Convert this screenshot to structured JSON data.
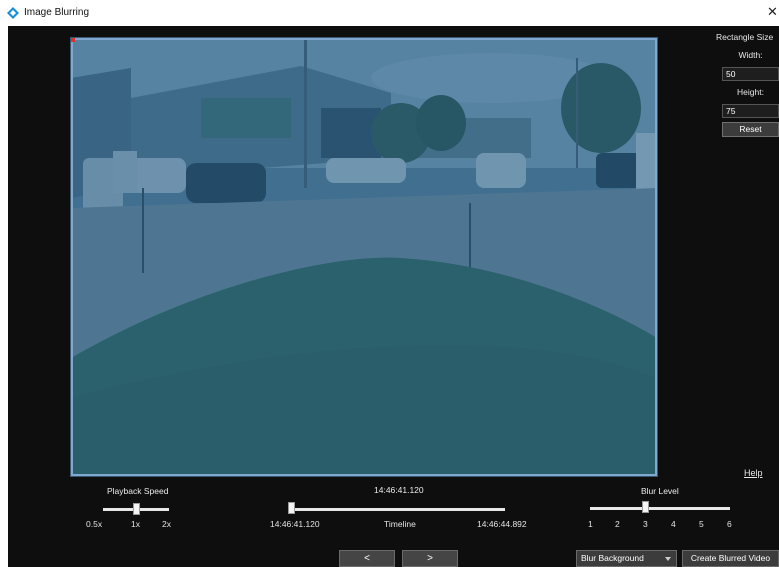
{
  "window": {
    "title": "Image Blurring",
    "close_glyph": "✕",
    "icon": "app-diamond-icon"
  },
  "colors": {
    "background": "#0e0e0e",
    "blur_overlay": "#1c5a87",
    "blur_border": "#7fa8d0",
    "accent_icon": "#1a8fd6"
  },
  "rectangle_size": {
    "title": "Rectangle Size",
    "width_label": "Width:",
    "width_value": "50",
    "height_label": "Height:",
    "height_value": "75",
    "reset_label": "Reset"
  },
  "help": {
    "label": "Help"
  },
  "playback_speed": {
    "label": "Playback Speed",
    "ticks": [
      "0.5x",
      "1x",
      "2x"
    ],
    "selected": "1x"
  },
  "timeline": {
    "current_time": "14:46:41.120",
    "label": "Timeline",
    "start_time": "14:46:41.120",
    "end_time": "14:46:44.892",
    "position": 0.0
  },
  "blur_level": {
    "label": "Blur Level",
    "ticks": [
      "1",
      "2",
      "3",
      "4",
      "5",
      "6"
    ],
    "selected": "3"
  },
  "navigation": {
    "prev_label": "<",
    "next_label": ">"
  },
  "blur_mode": {
    "selected": "Blur Background"
  },
  "create": {
    "label": "Create Blurred Video"
  }
}
